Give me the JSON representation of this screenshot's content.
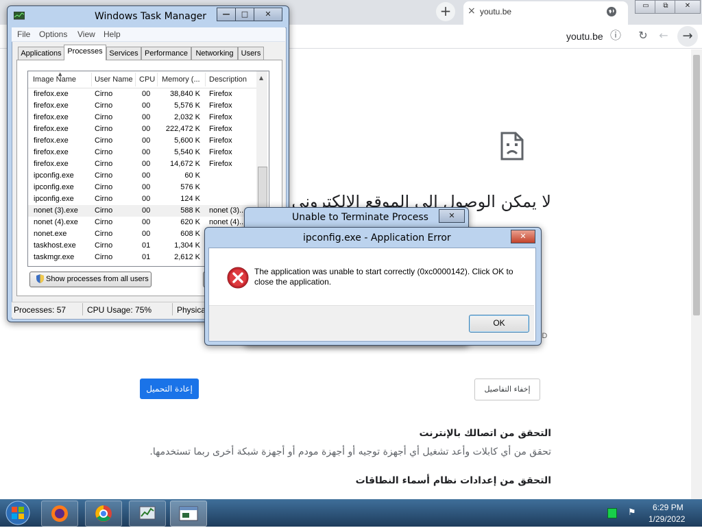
{
  "browser": {
    "tab_title": "youtu.be",
    "url": "youtu.be",
    "new_tab_label": "+",
    "tab_close": "×",
    "window_controls": [
      "▭",
      "⧉",
      "✕"
    ]
  },
  "error_page": {
    "heading": "لا يمكن الوصول إلى الموقع الإلكتروني",
    "error_code": "ED",
    "reload_button": "إعادة التحميل",
    "details_button": "إخفاء التفاصيل",
    "check1_title": "التحقق من اتصالك بالإنترنت",
    "check1_text": "تحقق من أي كابلات وأعد تشغيل أي أجهزة توجيه أو أجهزة مودم أو أجهزة شبكة أخرى ربما تستخدمها.",
    "check2_title": "التحقق من إعدادات نظام أسماء النطاقات",
    "accent": "#1a73e8"
  },
  "task_manager": {
    "title": "Windows Task Manager",
    "menu": [
      "File",
      "Options",
      "View",
      "Help"
    ],
    "tabs": [
      "Applications",
      "Processes",
      "Services",
      "Performance",
      "Networking",
      "Users"
    ],
    "active_tab": "Processes",
    "columns": [
      "Image Name",
      "User Name",
      "CPU",
      "Memory (...",
      "Description"
    ],
    "rows": [
      [
        "firefox.exe",
        "Cirno",
        "00",
        "38,840 K",
        "Firefox"
      ],
      [
        "firefox.exe",
        "Cirno",
        "00",
        "5,576 K",
        "Firefox"
      ],
      [
        "firefox.exe",
        "Cirno",
        "00",
        "2,032 K",
        "Firefox"
      ],
      [
        "firefox.exe",
        "Cirno",
        "00",
        "222,472 K",
        "Firefox"
      ],
      [
        "firefox.exe",
        "Cirno",
        "00",
        "5,600 K",
        "Firefox"
      ],
      [
        "firefox.exe",
        "Cirno",
        "00",
        "5,540 K",
        "Firefox"
      ],
      [
        "firefox.exe",
        "Cirno",
        "00",
        "14,672 K",
        "Firefox"
      ],
      [
        "ipconfig.exe",
        "Cirno",
        "00",
        "60 K",
        ""
      ],
      [
        "ipconfig.exe",
        "Cirno",
        "00",
        "576 K",
        ""
      ],
      [
        "ipconfig.exe",
        "Cirno",
        "00",
        "124 K",
        ""
      ],
      [
        "nonet (3).exe",
        "Cirno",
        "00",
        "588 K",
        "nonet (3)..."
      ],
      [
        "nonet (4).exe",
        "Cirno",
        "00",
        "620 K",
        "nonet (4)..."
      ],
      [
        "nonet.exe",
        "Cirno",
        "00",
        "608 K",
        ""
      ],
      [
        "taskhost.exe",
        "Cirno",
        "01",
        "1,304 K",
        ""
      ],
      [
        "taskmgr.exe",
        "Cirno",
        "01",
        "2,612 K",
        ""
      ]
    ],
    "show_all_button": "Show processes from all users",
    "status_processes": "Processes: 57",
    "status_cpu": "CPU Usage: 75%",
    "status_physical": "Physica"
  },
  "terminate_dialog": {
    "title": "Unable to Terminate Process"
  },
  "app_error": {
    "title": "ipconfig.exe - Application Error",
    "message": "The application was unable to start correctly (0xc0000142). Click OK to close the application.",
    "ok_button": "OK"
  },
  "taskbar": {
    "time": "6:29 PM",
    "date": "1/29/2022"
  }
}
